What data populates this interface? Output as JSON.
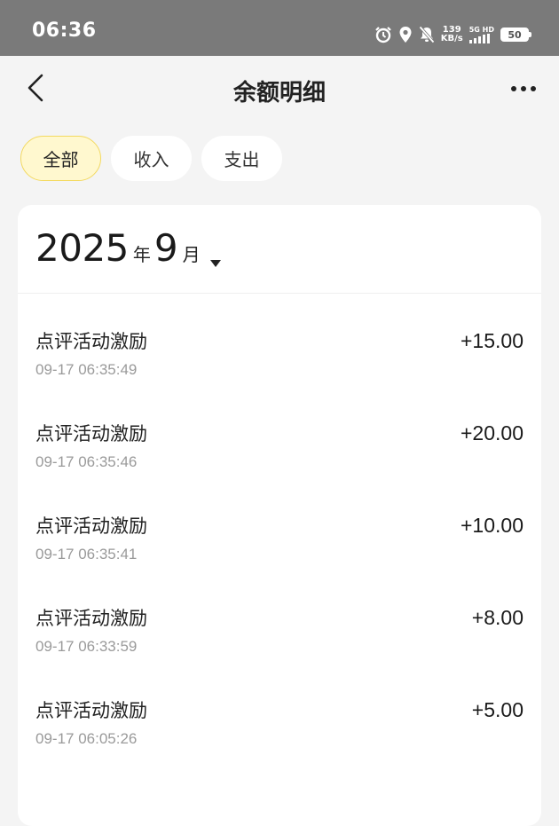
{
  "status_bar": {
    "time": "06:36",
    "net_speed_value": "139",
    "net_speed_unit": "KB/s",
    "signal_label": "5G HD",
    "battery": "50"
  },
  "nav": {
    "title": "余额明细"
  },
  "tabs": [
    {
      "label": "全部",
      "active": true
    },
    {
      "label": "收入",
      "active": false
    },
    {
      "label": "支出",
      "active": false
    }
  ],
  "month_selector": {
    "year": "2025",
    "year_unit": "年",
    "month": "9",
    "month_unit": "月"
  },
  "transactions": [
    {
      "title": "点评活动激励",
      "time": "09-17 06:35:49",
      "amount": "+15.00"
    },
    {
      "title": "点评活动激励",
      "time": "09-17 06:35:46",
      "amount": "+20.00"
    },
    {
      "title": "点评活动激励",
      "time": "09-17 06:35:41",
      "amount": "+10.00"
    },
    {
      "title": "点评活动激励",
      "time": "09-17 06:33:59",
      "amount": "+8.00"
    },
    {
      "title": "点评活动激励",
      "time": "09-17 06:05:26",
      "amount": "+5.00"
    }
  ],
  "colors": {
    "status_bar_bg": "#7a7a7a",
    "page_bg": "#f4f4f4",
    "active_tab_bg": "#fff8cf",
    "active_tab_border": "#f3d95f"
  }
}
